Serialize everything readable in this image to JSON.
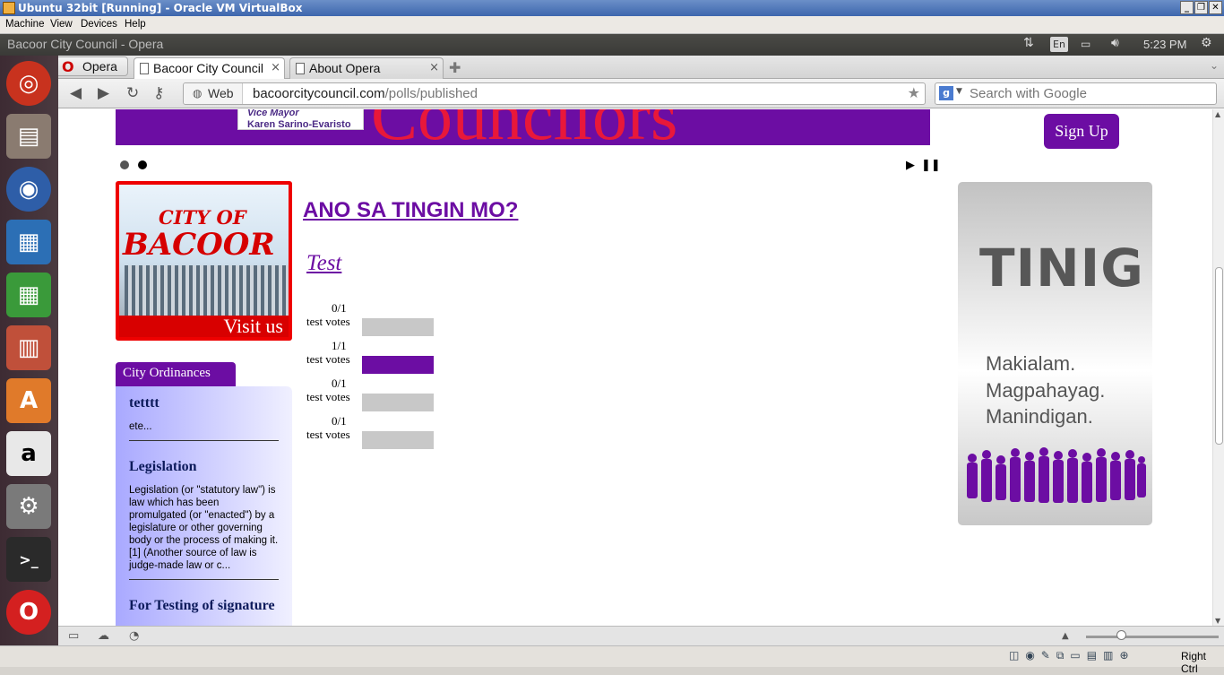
{
  "vbox": {
    "title": "Ubuntu 32bit [Running] - Oracle VM VirtualBox",
    "menu": [
      "Machine",
      "View",
      "Devices",
      "Help"
    ],
    "host_key": "Right Ctrl"
  },
  "ubuntu_panel": {
    "window_title": "Bacoor City Council - Opera",
    "lang": "En",
    "clock": "5:23 PM"
  },
  "launcher": [
    "ubuntu-icon",
    "files-icon",
    "firefox-icon",
    "writer-icon",
    "calc-icon",
    "impress-icon",
    "software-center-icon",
    "amazon-icon",
    "settings-icon",
    "terminal-icon",
    "opera-icon"
  ],
  "browser": {
    "menu_label": "Opera",
    "tabs": [
      {
        "label": "Bacoor City Council",
        "active": true
      },
      {
        "label": "About Opera",
        "active": false
      }
    ],
    "web_label": "Web",
    "url_host": "bacoorcitycouncil.com",
    "url_path": "/polls/published",
    "search_placeholder": "Search with Google"
  },
  "page": {
    "banner_text": "Councilors",
    "banner_vm_line1": "Vice Mayor",
    "banner_vm_line2": "Karen Sarino-Evaristo",
    "signup": "Sign Up",
    "visit_city_of": "CITY OF",
    "visit_bacoor": "BACOOR",
    "visit_us": "Visit us",
    "ordinances_title": "City Ordinances",
    "ordinances": [
      {
        "title": "tetttt",
        "body": "ete..."
      },
      {
        "title": "Legislation",
        "body": "Legislation (or \"statutory law\") is law which has been promulgated (or \"enacted\") by a legislature or other governing body or the process of making it.[1] (Another source of law is judge-made law or c..."
      },
      {
        "title": "For Testing of signature",
        "body": ""
      }
    ],
    "poll_title": "ANO SA TINGIN MO?",
    "poll_question": "Test",
    "poll_options": [
      {
        "fraction": "0/1",
        "label": "test votes",
        "value": 0
      },
      {
        "fraction": "1/1",
        "label": "test votes",
        "value": 1
      },
      {
        "fraction": "0/1",
        "label": "test votes",
        "value": 0
      },
      {
        "fraction": "0/1",
        "label": "test votes",
        "value": 0
      }
    ],
    "tinig_title": "TINIG",
    "tinig_lines": [
      "Makialam.",
      "Magpahayag.",
      "Manindigan."
    ]
  },
  "colors": {
    "purple": "#6c0da3",
    "red": "#e00000",
    "bar_empty": "#c8c8c8"
  }
}
